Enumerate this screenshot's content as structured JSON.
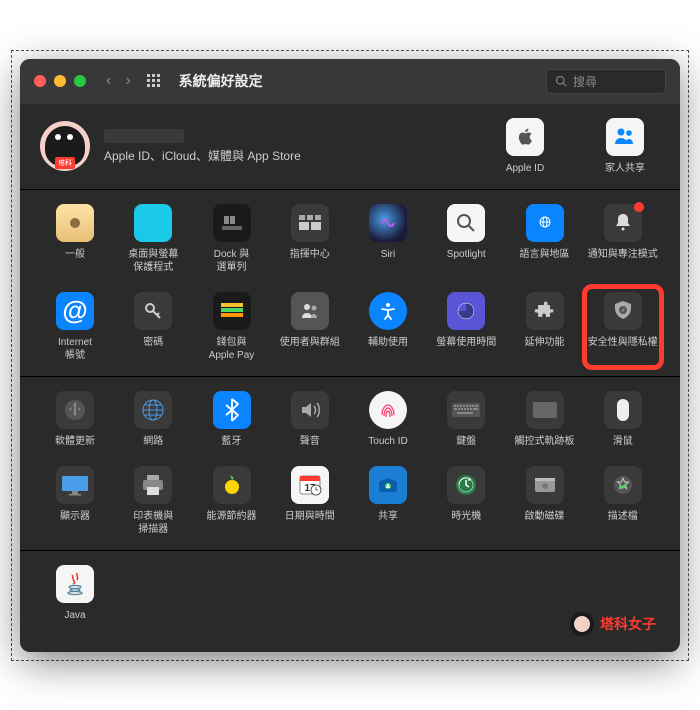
{
  "titlebar": {
    "title": "系統偏好設定",
    "search_placeholder": "搜尋"
  },
  "account": {
    "subtitle": "Apple ID、iCloud、媒體與 App Store",
    "avatar_label": "塔科"
  },
  "top_right": [
    {
      "id": "apple-id",
      "label": "Apple ID"
    },
    {
      "id": "family",
      "label": "家人共享"
    }
  ],
  "rows": [
    [
      {
        "id": "general",
        "label": "一般"
      },
      {
        "id": "desktop",
        "label": "桌面與螢幕\n保護程式"
      },
      {
        "id": "dock",
        "label": "Dock 與\n選單列"
      },
      {
        "id": "mission",
        "label": "指揮中心"
      },
      {
        "id": "siri",
        "label": "Siri"
      },
      {
        "id": "spotlight",
        "label": "Spotlight"
      },
      {
        "id": "language",
        "label": "語言與地區"
      },
      {
        "id": "notifications",
        "label": "通知與專注模式"
      }
    ],
    [
      {
        "id": "internet",
        "label": "Internet\n帳號"
      },
      {
        "id": "passwords",
        "label": "密碼"
      },
      {
        "id": "wallet",
        "label": "錢包與\nApple Pay"
      },
      {
        "id": "users",
        "label": "使用者與群組"
      },
      {
        "id": "accessibility",
        "label": "輔助使用"
      },
      {
        "id": "screentime",
        "label": "螢幕使用時間"
      },
      {
        "id": "extensions",
        "label": "延伸功能"
      },
      {
        "id": "security",
        "label": "安全性與隱私權",
        "highlighted": true
      }
    ],
    [
      {
        "id": "software",
        "label": "軟體更新"
      },
      {
        "id": "network",
        "label": "網路"
      },
      {
        "id": "bluetooth",
        "label": "藍牙"
      },
      {
        "id": "sound",
        "label": "聲音"
      },
      {
        "id": "touchid",
        "label": "Touch ID"
      },
      {
        "id": "keyboard",
        "label": "鍵盤"
      },
      {
        "id": "trackpad",
        "label": "觸控式軌跡板"
      },
      {
        "id": "mouse",
        "label": "滑鼠"
      }
    ],
    [
      {
        "id": "displays",
        "label": "顯示器"
      },
      {
        "id": "printers",
        "label": "印表機與\n掃描器"
      },
      {
        "id": "energy",
        "label": "能源節約器"
      },
      {
        "id": "datetime",
        "label": "日期與時間"
      },
      {
        "id": "sharing",
        "label": "共享"
      },
      {
        "id": "timemachine",
        "label": "時光機"
      },
      {
        "id": "startup",
        "label": "啟動磁碟"
      },
      {
        "id": "profiles",
        "label": "描述檔"
      }
    ],
    [
      {
        "id": "java",
        "label": "Java"
      }
    ]
  ],
  "watermark": "塔科女子"
}
